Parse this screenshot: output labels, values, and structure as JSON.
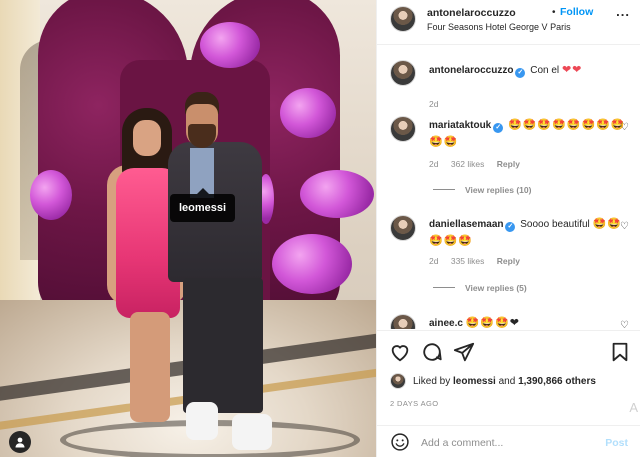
{
  "post": {
    "tag_label": "leomessi"
  },
  "header": {
    "username": "antonelaroccuzzo",
    "dot": "•",
    "follow_label": "Follow",
    "location": "Four Seasons Hotel George V Paris",
    "more": "..."
  },
  "caption": {
    "username": "antonelaroccuzzo",
    "text": "Con el",
    "emojis": "❤❤",
    "time": "2d"
  },
  "comments": [
    {
      "username": "mariataktouk",
      "text": "",
      "emojis": "🤩🤩🤩🤩🤩🤩🤩🤩🤩🤩",
      "time": "2d",
      "likes": "362 likes",
      "reply": "Reply",
      "view_replies": "View replies (10)"
    },
    {
      "username": "daniellasemaan",
      "text": "Soooo beautiful",
      "emojis": "🤩🤩🤩🤩🤩",
      "time": "2d",
      "likes": "335 likes",
      "reply": "Reply",
      "view_replies": "View replies (5)"
    },
    {
      "username": "ainee.c",
      "text": "",
      "emojis": "🤩🤩🤩❤",
      "time": "",
      "likes": "",
      "reply": "",
      "view_replies": ""
    }
  ],
  "likes": {
    "prefix": "Liked by",
    "user": "leomessi",
    "and": "and",
    "others": "1,390,866 others"
  },
  "date": "2 DAYS AGO",
  "add_comment": {
    "placeholder": "Add a comment...",
    "post_label": "Post"
  },
  "side_letter": "A",
  "icons": {
    "like": "heart-icon",
    "comment": "comment-icon",
    "share": "share-icon",
    "save": "bookmark-icon",
    "emoji": "emoji-icon",
    "tags": "user-tag-icon"
  },
  "colors": {
    "accent": "#0095f6",
    "verified": "#3897f0",
    "heart": "#ed4956",
    "post_disabled": "#b2dffc"
  }
}
